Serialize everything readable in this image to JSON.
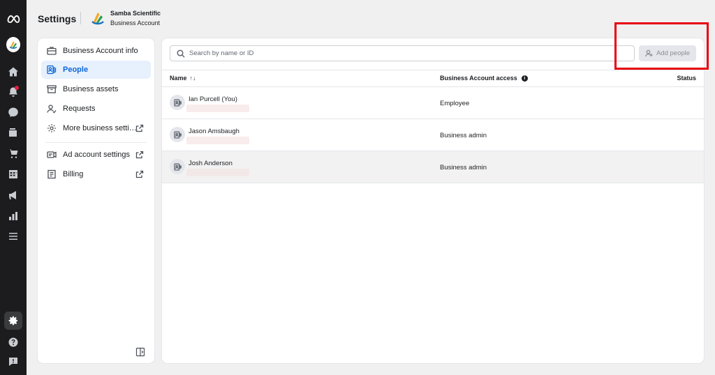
{
  "header": {
    "title": "Settings",
    "business_name": "Samba Scientific",
    "business_type": "Business Account"
  },
  "rail": {
    "icons": [
      "meta-logo-icon",
      "business-avatar-icon",
      "home-icon",
      "notifications-icon",
      "messages-icon",
      "pages-icon",
      "commerce-icon",
      "planner-icon",
      "ads-icon",
      "insights-icon",
      "menu-icon",
      "settings-icon",
      "help-icon",
      "feedback-icon"
    ]
  },
  "sidebar": {
    "items": [
      {
        "label": "Business Account info",
        "icon": "briefcase-icon"
      },
      {
        "label": "People",
        "icon": "people-icon",
        "selected": true
      },
      {
        "label": "Business assets",
        "icon": "assets-icon"
      },
      {
        "label": "Requests",
        "icon": "requests-icon"
      },
      {
        "label": "More business settings",
        "icon": "gear-icon",
        "external": true
      },
      {
        "label": "Ad account settings",
        "icon": "ad-account-icon",
        "external": true
      },
      {
        "label": "Billing",
        "icon": "billing-icon",
        "external": true
      }
    ]
  },
  "search": {
    "placeholder": "Search by name or ID",
    "value": ""
  },
  "add_people_label": "Add people",
  "table": {
    "headers": {
      "name": "Name",
      "sort_glyph": "↑↓",
      "access": "Business Account access",
      "status": "Status"
    },
    "rows": [
      {
        "name": "Ian Purcell (You)",
        "access": "Employee",
        "status": ""
      },
      {
        "name": "Jason Amsbaugh",
        "access": "Business admin",
        "status": ""
      },
      {
        "name": "Josh Anderson",
        "access": "Business admin",
        "status": ""
      }
    ]
  },
  "colors": {
    "accent": "#0a66d8",
    "highlight_box": "#e8000b",
    "rail_bg": "#1c1c1e"
  }
}
